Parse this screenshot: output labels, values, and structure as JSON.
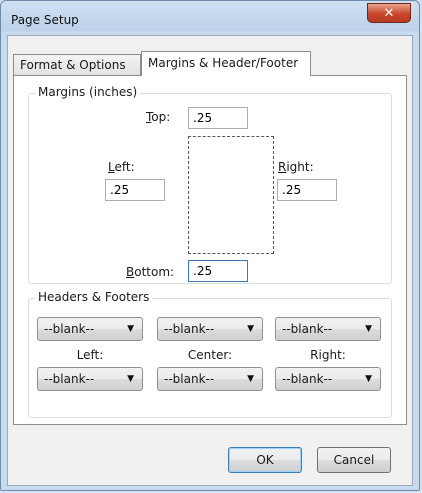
{
  "window": {
    "title": "Page Setup",
    "close_glyph": "✕"
  },
  "tabs": [
    {
      "label": "Format & Options",
      "active": false
    },
    {
      "label": "Margins & Header/Footer",
      "active": true
    }
  ],
  "margins": {
    "group_label": "Margins (inches)",
    "top": {
      "label_u": "T",
      "label_rest": "op:",
      "value": ".25"
    },
    "left": {
      "label_u": "L",
      "label_rest": "eft:",
      "value": ".25"
    },
    "right": {
      "label_u": "R",
      "label_rest": "ight:",
      "value": ".25"
    },
    "bottom": {
      "label_u": "B",
      "label_rest": "ottom:",
      "value": ".25"
    }
  },
  "headers_footers": {
    "group_label": "Headers & Footers",
    "headers": [
      "--blank--",
      "--blank--",
      "--blank--"
    ],
    "position_labels": [
      "Left:",
      "Center:",
      "Right:"
    ],
    "footers": [
      "--blank--",
      "--blank--",
      "--blank--"
    ],
    "arrow_glyph": "▼"
  },
  "buttons": {
    "ok": "OK",
    "cancel": "Cancel"
  }
}
